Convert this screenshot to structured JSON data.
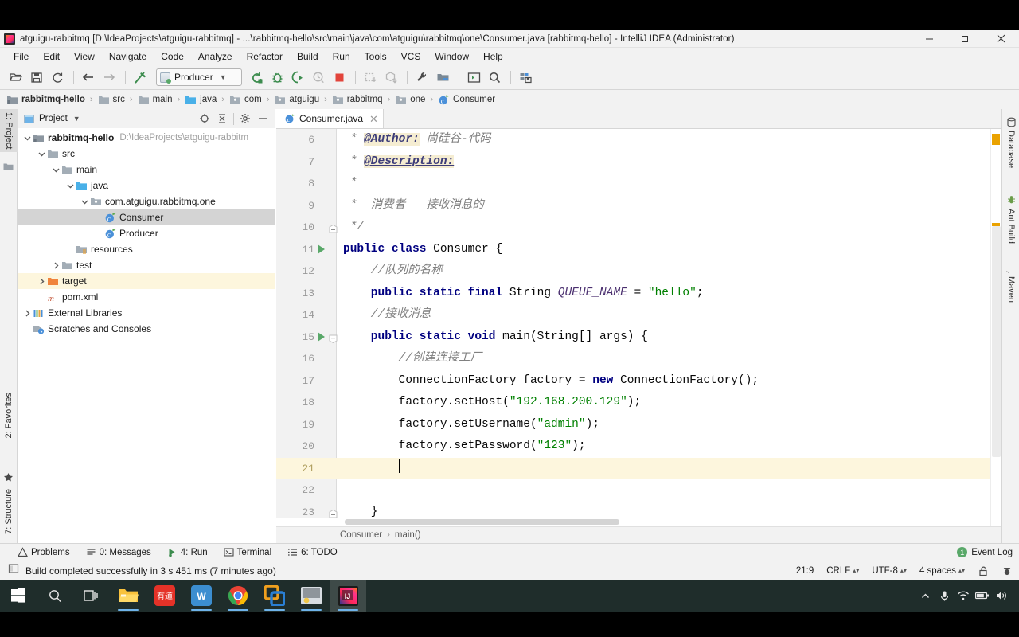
{
  "window": {
    "title": "atguigu-rabbitmq [D:\\IdeaProjects\\atguigu-rabbitmq] - ...\\rabbitmq-hello\\src\\main\\java\\com\\atguigu\\rabbitmq\\one\\Consumer.java [rabbitmq-hello] - IntelliJ IDEA (Administrator)",
    "app_icon": "intellij-idea-icon",
    "minimize": "minimize-button",
    "maximize": "restore-button",
    "close": "close-button"
  },
  "menubar": {
    "items": [
      {
        "label": "File"
      },
      {
        "label": "Edit"
      },
      {
        "label": "View"
      },
      {
        "label": "Navigate"
      },
      {
        "label": "Code"
      },
      {
        "label": "Analyze"
      },
      {
        "label": "Refactor"
      },
      {
        "label": "Build"
      },
      {
        "label": "Run"
      },
      {
        "label": "Tools"
      },
      {
        "label": "VCS"
      },
      {
        "label": "Window"
      },
      {
        "label": "Help"
      }
    ]
  },
  "toolbar": {
    "run_config": {
      "name": "Producer",
      "chevron": "chevron-down-icon"
    },
    "buttons": [
      "open-project-icon",
      "save-all-icon",
      "sync-refresh-icon",
      "navigate-back-icon",
      "navigate-forward-icon",
      "build-hammer-icon",
      "run-icon",
      "debug-icon",
      "run-with-coverage-icon",
      "profile-icon",
      "stop-icon",
      "update-project-icon",
      "commit-icon",
      "settings-wrench-icon",
      "project-structure-icon",
      "open-terminal-icon",
      "search-everywhere-icon",
      "save-db-icon"
    ]
  },
  "breadcrumb": {
    "items": [
      {
        "label": "rabbitmq-hello",
        "icon": "module-icon"
      },
      {
        "label": "src",
        "icon": "folder-icon"
      },
      {
        "label": "main",
        "icon": "folder-icon"
      },
      {
        "label": "java",
        "icon": "source-folder-icon"
      },
      {
        "label": "com",
        "icon": "package-icon"
      },
      {
        "label": "atguigu",
        "icon": "package-icon"
      },
      {
        "label": "rabbitmq",
        "icon": "package-icon"
      },
      {
        "label": "one",
        "icon": "package-icon"
      },
      {
        "label": "Consumer",
        "icon": "java-class-icon"
      }
    ],
    "separator": "›"
  },
  "left_rail": {
    "top": [
      {
        "label": "1: Project",
        "selected": true
      }
    ],
    "bottom": [
      {
        "label": "2: Favorites",
        "icon": "star-icon"
      },
      {
        "label": "7: Structure",
        "icon": "structure-icon"
      }
    ]
  },
  "right_rail": {
    "items": [
      {
        "label": "Database",
        "icon": "database-icon"
      },
      {
        "label": "Ant Build",
        "icon": "ant-icon"
      },
      {
        "label": "Maven",
        "icon": "maven-icon"
      }
    ]
  },
  "project_panel": {
    "title": "Project",
    "chevron": "chevron-down-icon",
    "actions": [
      "locate-target-icon",
      "collapse-all-icon",
      "settings-gear-icon",
      "hide-minimize-icon"
    ],
    "tree": [
      {
        "indent": 0,
        "arrow": "expanded",
        "icon": "module-icon",
        "label": "rabbitmq-hello",
        "bold": true,
        "path": "D:\\IdeaProjects\\atguigu-rabbitm",
        "state": "normal"
      },
      {
        "indent": 1,
        "arrow": "expanded",
        "icon": "folder-icon",
        "label": "src",
        "state": "normal"
      },
      {
        "indent": 2,
        "arrow": "expanded",
        "icon": "folder-icon",
        "label": "main",
        "state": "normal"
      },
      {
        "indent": 3,
        "arrow": "expanded",
        "icon": "source-folder-icon",
        "label": "java",
        "state": "normal"
      },
      {
        "indent": 4,
        "arrow": "expanded",
        "icon": "package-icon",
        "label": "com.atguigu.rabbitmq.one",
        "state": "normal"
      },
      {
        "indent": 5,
        "arrow": "none",
        "icon": "java-class-icon",
        "label": "Consumer",
        "state": "selected"
      },
      {
        "indent": 5,
        "arrow": "none",
        "icon": "java-class-icon",
        "label": "Producer",
        "state": "normal"
      },
      {
        "indent": 3,
        "arrow": "none",
        "icon": "resources-folder-icon",
        "label": "resources",
        "state": "normal"
      },
      {
        "indent": 2,
        "arrow": "collapsed",
        "icon": "folder-icon",
        "label": "test",
        "state": "normal"
      },
      {
        "indent": 1,
        "arrow": "collapsed",
        "icon": "target-folder-icon",
        "label": "target",
        "state": "highlight"
      },
      {
        "indent": 1,
        "arrow": "none",
        "icon": "maven-pom-icon",
        "label": "pom.xml",
        "state": "normal"
      },
      {
        "indent": 0,
        "arrow": "collapsed",
        "icon": "libraries-icon",
        "label": "External Libraries",
        "state": "normal"
      },
      {
        "indent": 0,
        "arrow": "none",
        "icon": "scratches-icon",
        "label": "Scratches and Consoles",
        "state": "normal"
      }
    ]
  },
  "editor": {
    "tab": {
      "label": "Consumer.java",
      "icon": "java-class-icon",
      "close": "close-tab-icon"
    },
    "first_line_number": 6,
    "caret_position": "21:9",
    "lines": [
      {
        "num": 6,
        "runnable": false,
        "fold": "none",
        "current": false,
        "tokens": [
          {
            "t": "doc",
            "v": " * "
          },
          {
            "t": "tag",
            "v": "@Author:"
          },
          {
            "t": "doc",
            "v": " 尚硅谷-代码"
          }
        ]
      },
      {
        "num": 7,
        "runnable": false,
        "fold": "none",
        "current": false,
        "tokens": [
          {
            "t": "doc",
            "v": " * "
          },
          {
            "t": "tag",
            "v": "@Description:"
          }
        ]
      },
      {
        "num": 8,
        "runnable": false,
        "fold": "none",
        "current": false,
        "tokens": [
          {
            "t": "doc",
            "v": " *"
          }
        ]
      },
      {
        "num": 9,
        "runnable": false,
        "fold": "none",
        "current": false,
        "tokens": [
          {
            "t": "doc",
            "v": " *  消费者   接收消息的"
          }
        ]
      },
      {
        "num": 10,
        "runnable": false,
        "fold": "end",
        "current": false,
        "tokens": [
          {
            "t": "doc",
            "v": " */"
          }
        ]
      },
      {
        "num": 11,
        "runnable": true,
        "fold": "none",
        "current": false,
        "tokens": [
          {
            "t": "kw",
            "v": "public class "
          },
          {
            "t": "plain",
            "v": "Consumer {"
          }
        ]
      },
      {
        "num": 12,
        "runnable": false,
        "fold": "none",
        "current": false,
        "tokens": [
          {
            "t": "cmt",
            "v": "    //队列的名称"
          }
        ]
      },
      {
        "num": 13,
        "runnable": false,
        "fold": "none",
        "current": false,
        "tokens": [
          {
            "t": "kw",
            "v": "    public static final "
          },
          {
            "t": "plain",
            "v": "String "
          },
          {
            "t": "fld",
            "v": "QUEUE_NAME"
          },
          {
            "t": "plain",
            "v": " = "
          },
          {
            "t": "str",
            "v": "\"hello\""
          },
          {
            "t": "plain",
            "v": ";"
          }
        ]
      },
      {
        "num": 14,
        "runnable": false,
        "fold": "none",
        "current": false,
        "tokens": [
          {
            "t": "cmt",
            "v": "    //接收消息"
          }
        ]
      },
      {
        "num": 15,
        "runnable": true,
        "fold": "start",
        "current": false,
        "tokens": [
          {
            "t": "kw",
            "v": "    public static void "
          },
          {
            "t": "plain",
            "v": "main(String[] args) {"
          }
        ]
      },
      {
        "num": 16,
        "runnable": false,
        "fold": "none",
        "current": false,
        "tokens": [
          {
            "t": "cmt",
            "v": "        //创建连接工厂"
          }
        ]
      },
      {
        "num": 17,
        "runnable": false,
        "fold": "none",
        "current": false,
        "tokens": [
          {
            "t": "plain",
            "v": "        ConnectionFactory factory = "
          },
          {
            "t": "kw",
            "v": "new "
          },
          {
            "t": "plain",
            "v": "ConnectionFactory();"
          }
        ]
      },
      {
        "num": 18,
        "runnable": false,
        "fold": "none",
        "current": false,
        "tokens": [
          {
            "t": "plain",
            "v": "        factory.setHost("
          },
          {
            "t": "str",
            "v": "\"192.168.200.129\""
          },
          {
            "t": "plain",
            "v": ");"
          }
        ]
      },
      {
        "num": 19,
        "runnable": false,
        "fold": "none",
        "current": false,
        "tokens": [
          {
            "t": "plain",
            "v": "        factory.setUsername("
          },
          {
            "t": "str",
            "v": "\"admin\""
          },
          {
            "t": "plain",
            "v": ");"
          }
        ]
      },
      {
        "num": 20,
        "runnable": false,
        "fold": "none",
        "current": false,
        "tokens": [
          {
            "t": "plain",
            "v": "        factory.setPassword("
          },
          {
            "t": "str",
            "v": "\"123\""
          },
          {
            "t": "plain",
            "v": ");"
          }
        ]
      },
      {
        "num": 21,
        "runnable": false,
        "fold": "none",
        "current": true,
        "tokens": [
          {
            "t": "plain",
            "v": "        "
          }
        ]
      },
      {
        "num": 22,
        "runnable": false,
        "fold": "none",
        "current": false,
        "tokens": []
      },
      {
        "num": 23,
        "runnable": false,
        "fold": "end",
        "current": false,
        "tokens": [
          {
            "t": "plain",
            "v": "    }"
          }
        ]
      }
    ],
    "bottom_breadcrumb": {
      "class": "Consumer",
      "method": "main()",
      "separator": "›"
    }
  },
  "bottom_toolwindows": {
    "items": [
      {
        "label": "Problems",
        "icon": "problems-warning-icon",
        "mnemonic": ""
      },
      {
        "label": "0: Messages",
        "icon": "messages-icon",
        "mnemonic": "0"
      },
      {
        "label": "4: Run",
        "icon": "run-green-icon",
        "mnemonic": "4"
      },
      {
        "label": "Terminal",
        "icon": "terminal-icon",
        "mnemonic": ""
      },
      {
        "label": "6: TODO",
        "icon": "todo-list-icon",
        "mnemonic": "6"
      }
    ],
    "event_log": {
      "label": "Event Log",
      "count": "1",
      "color": "#59a869"
    }
  },
  "statusbar": {
    "icon": "build-status-icon",
    "message": "Build completed successfully in 3 s 451 ms (7 minutes ago)",
    "caret": "21:9",
    "line_separator": "CRLF",
    "encoding": "UTF-8",
    "indent": "4 spaces",
    "lock": "unlocked-padlock-icon",
    "inspector": "inspector-hector-icon"
  },
  "taskbar": {
    "items": [
      {
        "name": "start-button",
        "icon": "windows-logo-icon",
        "open": false
      },
      {
        "name": "search-button",
        "icon": "search-icon",
        "open": false
      },
      {
        "name": "task-view-button",
        "icon": "task-view-icon",
        "open": false
      },
      {
        "name": "file-explorer",
        "icon": "file-explorer-icon",
        "open": true
      },
      {
        "name": "youdao-dict",
        "icon": "youdao-icon",
        "open": false
      },
      {
        "name": "wps-office",
        "icon": "wps-icon",
        "open": true
      },
      {
        "name": "google-chrome",
        "icon": "chrome-icon",
        "open": true
      },
      {
        "name": "vmware-workstation",
        "icon": "vmware-icon",
        "open": true
      },
      {
        "name": "snipaste",
        "icon": "snipaste-icon",
        "open": true
      },
      {
        "name": "intellij-idea",
        "icon": "intellij-idea-icon",
        "open": true,
        "active": true
      }
    ],
    "tray": [
      {
        "name": "show-hidden-icons",
        "icon": "chevron-up-icon"
      },
      {
        "name": "microphone",
        "icon": "microphone-icon"
      },
      {
        "name": "network",
        "icon": "wifi-icon"
      },
      {
        "name": "battery",
        "icon": "battery-icon"
      },
      {
        "name": "volume",
        "icon": "speaker-icon"
      }
    ]
  },
  "colors": {
    "accent_green": "#59a869",
    "warning_marker": "#eaa200",
    "current_line": "#fdf6dd",
    "selection": "#d4d4d4",
    "string": "#008000",
    "keyword": "#000080",
    "comment": "#808080"
  }
}
